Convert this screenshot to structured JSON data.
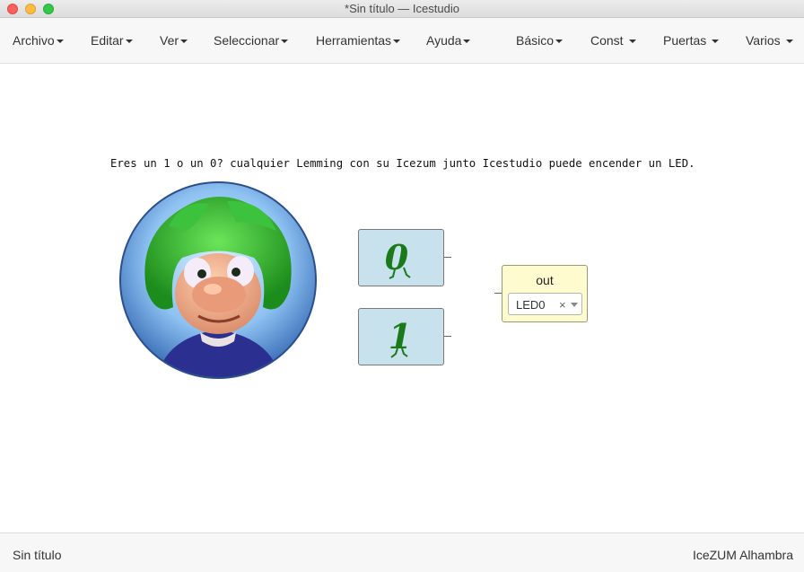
{
  "window": {
    "title": "*Sin título — Icestudio"
  },
  "menubar": {
    "left": [
      "Archivo",
      "Editar",
      "Ver",
      "Seleccionar",
      "Herramientas",
      "Ayuda"
    ],
    "right": [
      "Básico",
      "Const",
      "Puertas",
      "Varios"
    ]
  },
  "canvas": {
    "info_text": "Eres un 1 o un 0? cualquier Lemming con su Icezum junto Icestudio puede encender un LED.",
    "constants": [
      {
        "value": "0",
        "color": "#1a7a1a"
      },
      {
        "value": "1",
        "color": "#1a7a1a"
      }
    ],
    "output": {
      "label": "out",
      "pin": "LED0",
      "clear_symbol": "×"
    }
  },
  "footer": {
    "left": "Sin título",
    "right": "IceZUM Alhambra"
  }
}
